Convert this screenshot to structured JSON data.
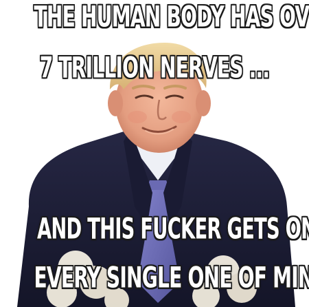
{
  "meme": {
    "top_text": {
      "line1": "THE HUMAN BODY HAS OVER",
      "line2": "7 TRILLION NERVES ..."
    },
    "bottom_text": {
      "line1": "AND THIS FUCKER GETS ON",
      "line2": "EVERY SINGLE ONE OF MINE"
    }
  },
  "colors": {
    "suit": "#1e1f3a",
    "tie": "#6f6fb8",
    "skin": "#e9a88c",
    "hair": "#e6c98a",
    "caption_fill": "#ffffff",
    "caption_outline": "#1a1a1a"
  }
}
